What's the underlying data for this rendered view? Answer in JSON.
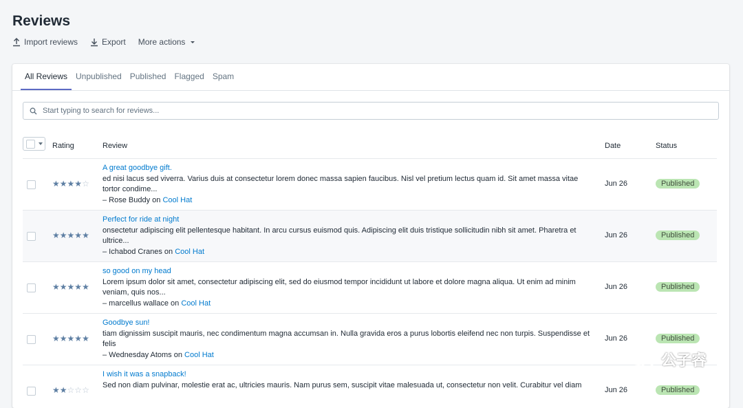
{
  "page": {
    "title": "Reviews"
  },
  "actions": {
    "import_label": "Import reviews",
    "export_label": "Export",
    "more_label": "More actions"
  },
  "tabs": [
    {
      "label": "All Reviews",
      "active": true
    },
    {
      "label": "Unpublished"
    },
    {
      "label": "Published"
    },
    {
      "label": "Flagged"
    },
    {
      "label": "Spam"
    }
  ],
  "search": {
    "placeholder": "Start typing to search for reviews..."
  },
  "table": {
    "headers": {
      "rating": "Rating",
      "review": "Review",
      "date": "Date",
      "status": "Status"
    },
    "rows": [
      {
        "rating": 4,
        "title": "A great goodbye gift.",
        "body": "ed nisi lacus sed viverra. Varius duis at consectetur lorem donec massa sapien faucibus. Nisl vel pretium lectus quam id. Sit amet massa vitae tortor condime...",
        "author": "– Rose Buddy on",
        "product": "Cool Hat",
        "date": "Jun 26",
        "status": "Published"
      },
      {
        "rating": 5,
        "title": "Perfect for ride at night",
        "body": "onsectetur adipiscing elit pellentesque habitant. In arcu cursus euismod quis. Adipiscing elit duis tristique sollicitudin nibh sit amet. Pharetra et ultrice...",
        "author": "– Ichabod Cranes on",
        "product": "Cool Hat",
        "date": "Jun 26",
        "status": "Published"
      },
      {
        "rating": 5,
        "title": "so good on my head",
        "body": "Lorem ipsum dolor sit amet, consectetur adipiscing elit, sed do eiusmod tempor incididunt ut labore et dolore magna aliqua. Ut enim ad minim veniam, quis nos...",
        "author": "– marcellus wallace on",
        "product": "Cool Hat",
        "date": "Jun 26",
        "status": "Published"
      },
      {
        "rating": 5,
        "title": "Goodbye sun!",
        "body": "tiam dignissim suscipit mauris, nec condimentum magna accumsan in. Nulla gravida eros a purus lobortis eleifend nec non turpis. Suspendisse et felis",
        "author": "– Wednesday Atoms on",
        "product": "Cool Hat",
        "date": "Jun 26",
        "status": "Published"
      },
      {
        "rating": 2,
        "title": "I wish it was a snapback!",
        "body": "Sed non diam pulvinar, molestie erat ac, ultricies mauris. Nam purus sem, suscipit vitae malesuada ut, consectetur non velit. Curabitur vel diam",
        "author": "",
        "product": "",
        "date": "Jun 26",
        "status": "Published"
      }
    ]
  },
  "watermark": {
    "text": "公子睿"
  },
  "colors": {
    "accent": "#5c6ac4",
    "link": "#007ace",
    "badge_bg": "#bbe5b3",
    "star": "#5e7fa3"
  }
}
